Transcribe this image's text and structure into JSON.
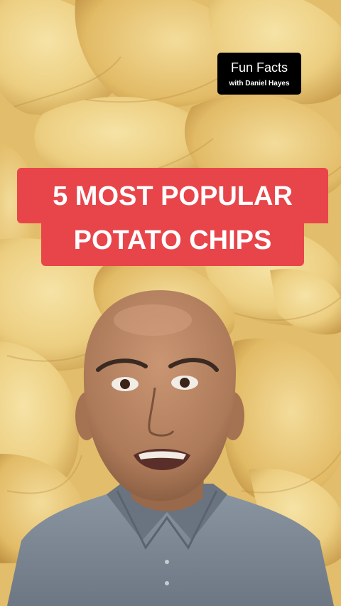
{
  "overlay": {
    "series_title": "Fun Facts",
    "series_host": "with Daniel Hayes",
    "headline_line1": "5 MOST POPULAR",
    "headline_line2": "POTATO CHIPS"
  },
  "colors": {
    "headline_bg": "#e8454a",
    "badge_bg": "#000000",
    "chip_background": "#e9c975",
    "shirt": "#7e8a98",
    "skin": "#b88463"
  },
  "video": {
    "background": "potato-chips-closeup",
    "presenter": "bald-man-in-grey-polo"
  }
}
